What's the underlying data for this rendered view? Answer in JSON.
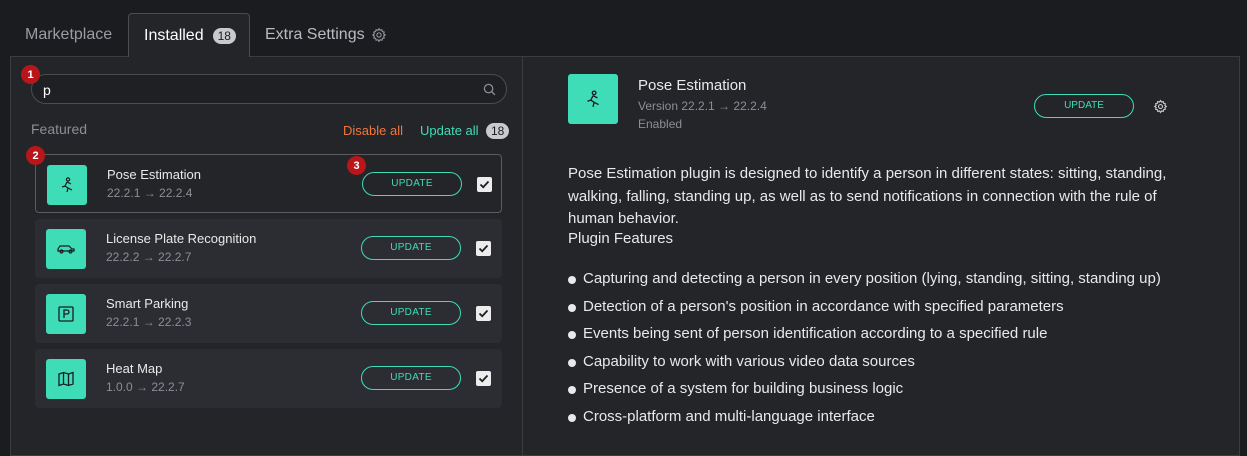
{
  "tabs": {
    "marketplace": "Marketplace",
    "installed": "Installed",
    "installed_count": "18",
    "extra": "Extra Settings"
  },
  "search": {
    "value": "p",
    "placeholder": ""
  },
  "markers": {
    "m1": "1",
    "m2": "2",
    "m3": "3"
  },
  "list_header": {
    "featured": "Featured",
    "disable_all": "Disable all",
    "update_all": "Update all",
    "update_all_count": "18"
  },
  "plugins": [
    {
      "name": "Pose Estimation",
      "version": "22.2.1 → 22.2.4",
      "button": "UPDATE",
      "icon": "pose-icon",
      "checked": true
    },
    {
      "name": "License Plate Recognition",
      "version": "22.2.2 → 22.2.7",
      "button": "UPDATE",
      "icon": "car-icon",
      "checked": true
    },
    {
      "name": "Smart Parking",
      "version": "22.2.1 → 22.2.3",
      "button": "UPDATE",
      "icon": "parking-icon",
      "checked": true
    },
    {
      "name": "Heat Map",
      "version": "1.0.0 → 22.2.7",
      "button": "UPDATE",
      "icon": "map-icon",
      "checked": true
    }
  ],
  "detail": {
    "title": "Pose Estimation",
    "version": "Version 22.2.1 → 22.2.4",
    "status": "Enabled",
    "button": "UPDATE",
    "description": "Pose Estimation plugin is designed to identify a person in different states: sitting, standing, walking, falling, standing up, as well as to send notifications in connection with the rule of human behavior.",
    "features_title": "Plugin Features",
    "features": [
      "Capturing and detecting a person in every position (lying, standing, sitting, standing up)",
      "Detection of a person's position in accordance with specified parameters",
      "Events being sent of person identification according to a specified rule",
      "Capability to work with various video data sources",
      "Presence of a system for building business logic",
      "Cross-platform and multi-language interface"
    ]
  },
  "colors": {
    "accent": "#3fdcb8",
    "danger": "#f2763c",
    "marker": "#b8161a",
    "background": "#1b1c1f",
    "panel": "#232529"
  }
}
